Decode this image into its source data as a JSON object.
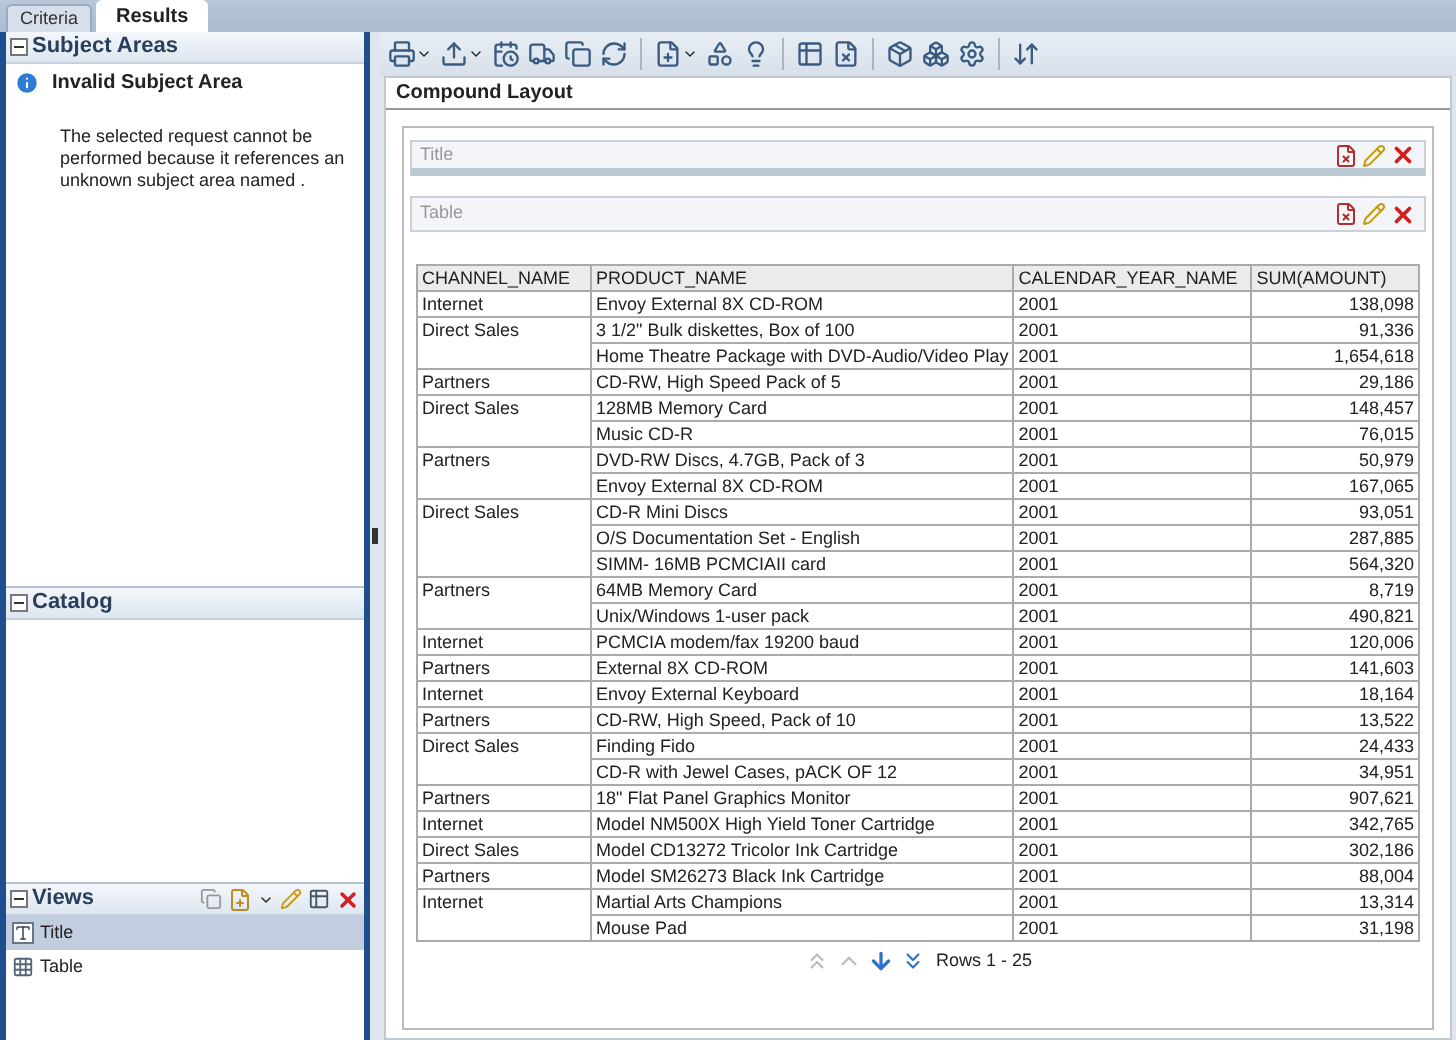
{
  "tabs": [
    {
      "label": "Criteria",
      "selected": false
    },
    {
      "label": "Results",
      "selected": true
    }
  ],
  "subject_areas": {
    "title": "Subject Areas",
    "expanded": true,
    "message_title": "Invalid Subject Area",
    "message": "The selected request cannot be performed because it references an unknown subject area named ."
  },
  "catalog": {
    "title": "Catalog",
    "expanded": true
  },
  "views": {
    "title": "Views",
    "expanded": true,
    "items": [
      {
        "label": "Title",
        "kind": "title",
        "selected": true
      },
      {
        "label": "Table",
        "kind": "table",
        "selected": false
      }
    ]
  },
  "layout": {
    "title": "Compound Layout",
    "view_bars": [
      "Title",
      "Table"
    ]
  },
  "table": {
    "columns": [
      "CHANNEL_NAME",
      "PRODUCT_NAME",
      "CALENDAR_YEAR_NAME",
      "SUM(AMOUNT)"
    ],
    "groups": [
      {
        "channel": "Internet",
        "rows": [
          [
            "Envoy External 8X CD-ROM",
            "2001",
            "138,098"
          ]
        ]
      },
      {
        "channel": "Direct Sales",
        "rows": [
          [
            "3 1/2\" Bulk diskettes, Box of 100",
            "2001",
            "91,336"
          ],
          [
            "Home Theatre Package with DVD-Audio/Video Play",
            "2001",
            "1,654,618"
          ]
        ]
      },
      {
        "channel": "Partners",
        "rows": [
          [
            "CD-RW, High Speed Pack of 5",
            "2001",
            "29,186"
          ]
        ]
      },
      {
        "channel": "Direct Sales",
        "rows": [
          [
            "128MB Memory Card",
            "2001",
            "148,457"
          ],
          [
            "Music CD-R",
            "2001",
            "76,015"
          ]
        ]
      },
      {
        "channel": "Partners",
        "rows": [
          [
            "DVD-RW Discs, 4.7GB, Pack of 3",
            "2001",
            "50,979"
          ],
          [
            "Envoy External 8X CD-ROM",
            "2001",
            "167,065"
          ]
        ]
      },
      {
        "channel": "Direct Sales",
        "rows": [
          [
            "CD-R Mini Discs",
            "2001",
            "93,051"
          ],
          [
            "O/S Documentation Set - English",
            "2001",
            "287,885"
          ],
          [
            "SIMM- 16MB PCMCIAII card",
            "2001",
            "564,320"
          ]
        ]
      },
      {
        "channel": "Partners",
        "rows": [
          [
            "64MB Memory Card",
            "2001",
            "8,719"
          ],
          [
            "Unix/Windows 1-user pack",
            "2001",
            "490,821"
          ]
        ]
      },
      {
        "channel": "Internet",
        "rows": [
          [
            "PCMCIA modem/fax 19200 baud",
            "2001",
            "120,006"
          ]
        ]
      },
      {
        "channel": "Partners",
        "rows": [
          [
            "External 8X CD-ROM",
            "2001",
            "141,603"
          ]
        ]
      },
      {
        "channel": "Internet",
        "rows": [
          [
            "Envoy External Keyboard",
            "2001",
            "18,164"
          ]
        ]
      },
      {
        "channel": "Partners",
        "rows": [
          [
            "CD-RW, High Speed, Pack of 10",
            "2001",
            "13,522"
          ]
        ]
      },
      {
        "channel": "Direct Sales",
        "rows": [
          [
            "Finding Fido",
            "2001",
            "24,433"
          ],
          [
            "CD-R with Jewel Cases, pACK OF 12",
            "2001",
            "34,951"
          ]
        ]
      },
      {
        "channel": "Partners",
        "rows": [
          [
            "18\" Flat Panel Graphics Monitor",
            "2001",
            "907,621"
          ]
        ]
      },
      {
        "channel": "Internet",
        "rows": [
          [
            "Model NM500X High Yield Toner Cartridge",
            "2001",
            "342,765"
          ]
        ]
      },
      {
        "channel": "Direct Sales",
        "rows": [
          [
            "Model CD13272 Tricolor Ink Cartridge",
            "2001",
            "302,186"
          ]
        ]
      },
      {
        "channel": "Partners",
        "rows": [
          [
            "Model SM26273 Black Ink Cartridge",
            "2001",
            "88,004"
          ]
        ]
      },
      {
        "channel": "Internet",
        "rows": [
          [
            "Martial Arts Champions",
            "2001",
            "13,314"
          ],
          [
            "Mouse Pad",
            "2001",
            "31,198"
          ]
        ]
      }
    ]
  },
  "pager": {
    "label": "Rows 1 - 25"
  }
}
